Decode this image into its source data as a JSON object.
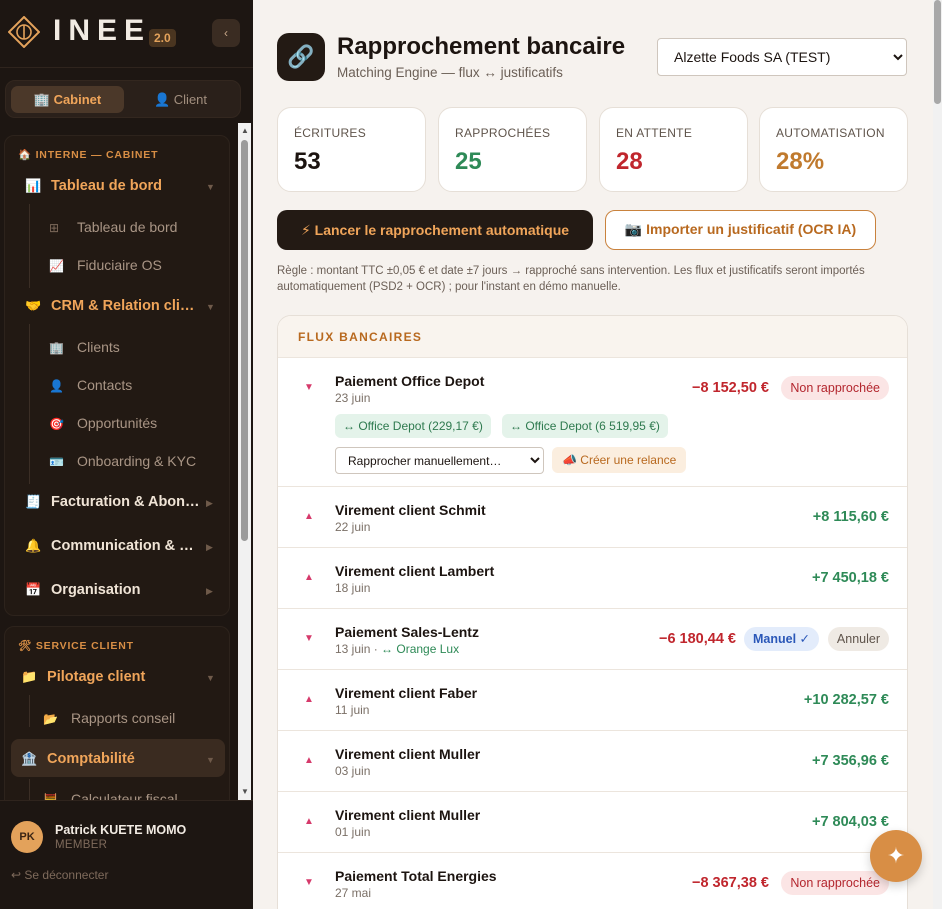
{
  "app": {
    "name": "INEE",
    "version": "2.0",
    "collapse_icon": "‹"
  },
  "mode_switch": {
    "options": [
      {
        "icon": "🏢",
        "label": "Cabinet",
        "active": true
      },
      {
        "icon": "👤",
        "label": "Client",
        "active": false
      }
    ]
  },
  "sidebar": {
    "internal": {
      "title": "🏠 INTERNE — CABINET",
      "items": [
        {
          "icon": "📊",
          "label": "Tableau de bord",
          "expanded": true,
          "children": [
            {
              "icon": "⊞",
              "label": "Tableau de bord"
            },
            {
              "icon": "📈",
              "label": "Fiduciaire OS"
            }
          ]
        },
        {
          "icon": "🤝",
          "label": "CRM & Relation cli…",
          "expanded": true,
          "children": [
            {
              "icon": "🏢",
              "label": "Clients"
            },
            {
              "icon": "👤",
              "label": "Contacts"
            },
            {
              "icon": "🎯",
              "label": "Opportunités"
            },
            {
              "icon": "🪪",
              "label": "Onboarding & KYC"
            }
          ]
        },
        {
          "icon": "🧾",
          "label": "Facturation & Abon…",
          "expanded": false
        },
        {
          "icon": "🔔",
          "label": "Communication & …",
          "expanded": false
        },
        {
          "icon": "📅",
          "label": "Organisation",
          "expanded": false
        }
      ]
    },
    "client_service": {
      "title": "🛠 SERVICE CLIENT",
      "items": [
        {
          "icon": "📁",
          "label": "Pilotage client",
          "expanded": true,
          "children": [
            {
              "icon": "📂",
              "label": "Rapports conseil"
            }
          ]
        },
        {
          "icon": "🏦",
          "label": "Comptabilité",
          "expanded": true,
          "active": true,
          "children": [
            {
              "icon": "🧮",
              "label": "Calculateur fiscal"
            }
          ]
        }
      ]
    }
  },
  "user": {
    "initials": "PK",
    "name": "Patrick KUETE MOMO",
    "role": "MEMBER",
    "logout": "↩ Se déconnecter"
  },
  "page": {
    "icon": "🔗",
    "title": "Rapprochement bancaire",
    "subtitle": "Matching Engine — flux ↔ justificatifs",
    "company": "Alzette Foods SA (TEST)"
  },
  "stats": [
    {
      "label": "ÉCRITURES",
      "value": "53",
      "color": "#1c1410"
    },
    {
      "label": "RAPPROCHÉES",
      "value": "25",
      "color": "#2e8a57"
    },
    {
      "label": "EN ATTENTE",
      "value": "28",
      "color": "#c0262d"
    },
    {
      "label": "AUTOMATISATION",
      "value": "28%",
      "color": "#c07a2e"
    }
  ],
  "actions": {
    "auto_match": "⚡ Lancer le rapprochement automatique",
    "import": "📷 Importer un justificatif (OCR IA)"
  },
  "rule_note": "Règle : montant TTC ±0,05 € et date ±7 jours → rapproché sans intervention. Les flux et justificatifs seront importés automatiquement (PSD2 + OCR) ; pour l'instant en démo manuelle.",
  "flux": {
    "title": "FLUX BANCAIRES",
    "manual_placeholder": "Rapprocher manuellement…",
    "relance_label": "📣 Créer une relance",
    "rows": [
      {
        "direction": "down",
        "title": "Paiement Office Depot",
        "date": "23 juin",
        "amount": "−8 152,50 €",
        "sign": "neg",
        "status": "Non rapprochée",
        "suggestions": [
          "↔ Office Depot (229,17 €)",
          "↔ Office Depot (6 519,95 €)"
        ]
      },
      {
        "direction": "up",
        "title": "Virement client Schmit",
        "date": "22 juin",
        "amount": "+8 115,60 €",
        "sign": "pos"
      },
      {
        "direction": "up",
        "title": "Virement client Lambert",
        "date": "18 juin",
        "amount": "+7 450,18 €",
        "sign": "pos"
      },
      {
        "direction": "down",
        "title": "Paiement Sales-Lentz",
        "date": "13 juin · ",
        "match": "↔ Orange Lux",
        "amount": "−6 180,44 €",
        "sign": "neg",
        "badge": "Manuel ✓",
        "undo": "Annuler"
      },
      {
        "direction": "up",
        "title": "Virement client Faber",
        "date": "11 juin",
        "amount": "+10 282,57 €",
        "sign": "pos"
      },
      {
        "direction": "up",
        "title": "Virement client Muller",
        "date": "03 juin",
        "amount": "+7 356,96 €",
        "sign": "pos"
      },
      {
        "direction": "up",
        "title": "Virement client Muller",
        "date": "01 juin",
        "amount": "+7 804,03 €",
        "sign": "pos"
      },
      {
        "direction": "down",
        "title": "Paiement Total Energies",
        "date": "27 mai",
        "amount": "−8 367,38 €",
        "sign": "neg",
        "status": "Non rapprochée"
      }
    ]
  },
  "fab_icon": "✦",
  "colors": {
    "accent": "#d88e45",
    "sidebar_bg": "#1d1612",
    "positive": "#2e8a57",
    "negative": "#c0262d"
  }
}
